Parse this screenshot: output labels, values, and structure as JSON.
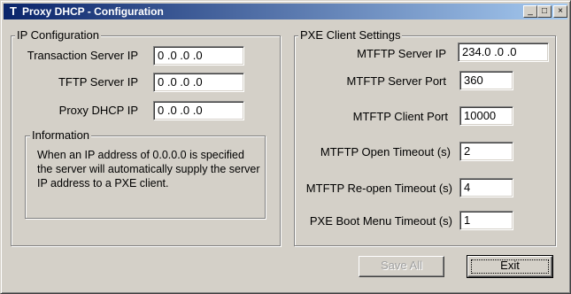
{
  "window": {
    "title": "Proxy DHCP - Configuration",
    "app_icon": "T"
  },
  "controls": {
    "minimize": "_",
    "maximize": "□",
    "close": "×"
  },
  "ip_config": {
    "legend": "IP Configuration",
    "transaction_server_ip_label": "Transaction Server IP",
    "transaction_server_ip_value": "0 .0 .0 .0",
    "tftp_server_ip_label": "TFTP Server IP",
    "tftp_server_ip_value": "0 .0 .0 .0",
    "proxy_dhcp_ip_label": "Proxy DHCP IP",
    "proxy_dhcp_ip_value": "0 .0 .0 .0"
  },
  "information": {
    "legend": "Information",
    "text": "When an IP address of 0.0.0.0 is specified the server will automatically supply the server IP address to a PXE client."
  },
  "pxe": {
    "legend": "PXE Client Settings",
    "mtftp_server_ip_label": "MTFTP Server IP",
    "mtftp_server_ip_value": "234.0 .0 .0",
    "mtftp_server_port_label": "MTFTP Server Port",
    "mtftp_server_port_value": "360",
    "mtftp_client_port_label": "MTFTP Client Port",
    "mtftp_client_port_value": "10000",
    "open_timeout_label": "MTFTP Open Timeout (s)",
    "open_timeout_value": "2",
    "reopen_timeout_label": "MTFTP Re-open Timeout (s)",
    "reopen_timeout_value": "4",
    "boot_menu_timeout_label": "PXE Boot Menu Timeout (s)",
    "boot_menu_timeout_value": "1"
  },
  "buttons": {
    "save_all": "Save All",
    "exit": "Exit"
  }
}
